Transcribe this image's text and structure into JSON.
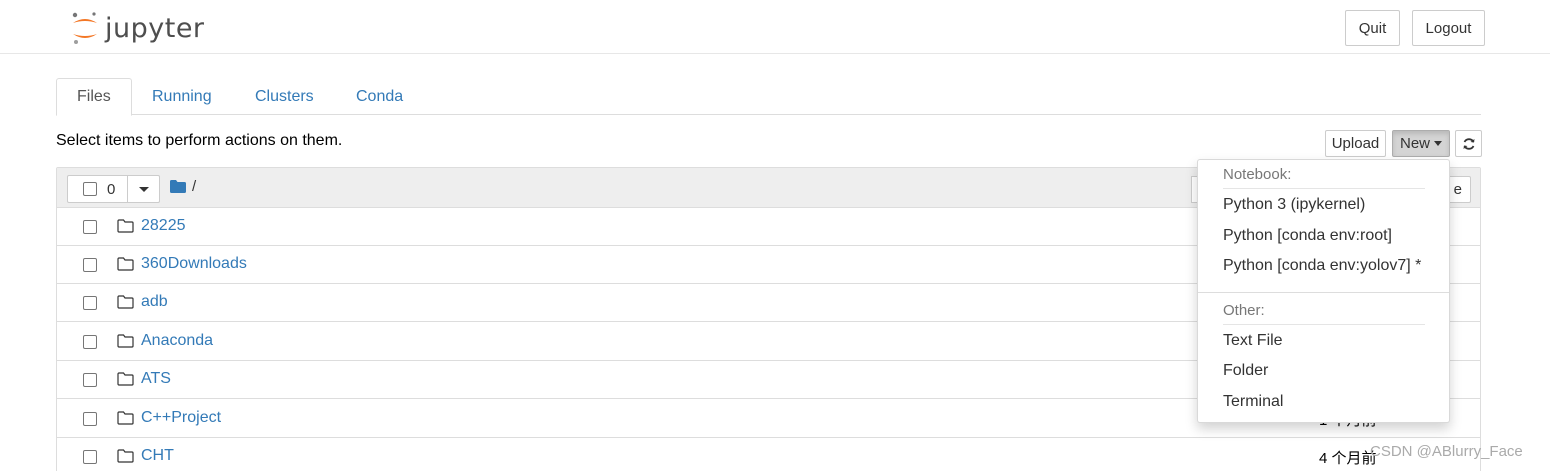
{
  "header": {
    "logo_text": "jupyter",
    "quit_label": "Quit",
    "logout_label": "Logout"
  },
  "tabs": [
    {
      "label": "Files",
      "active": true
    },
    {
      "label": "Running",
      "active": false
    },
    {
      "label": "Clusters",
      "active": false
    },
    {
      "label": "Conda",
      "active": false
    }
  ],
  "toolbar": {
    "hint": "Select items to perform actions on them.",
    "upload_label": "Upload",
    "new_label": "New",
    "refresh_icon": "refresh-icon"
  },
  "list_header": {
    "selected_count": "0",
    "breadcrumb_root": "/",
    "name_button_partial": "e"
  },
  "files": [
    {
      "name": "28225",
      "type": "folder",
      "modified": ""
    },
    {
      "name": "360Downloads",
      "type": "folder",
      "modified": ""
    },
    {
      "name": "adb",
      "type": "folder",
      "modified": ""
    },
    {
      "name": "Anaconda",
      "type": "folder",
      "modified": ""
    },
    {
      "name": "ATS",
      "type": "folder",
      "modified": ""
    },
    {
      "name": "C++Project",
      "type": "folder",
      "modified": "1 个月前"
    },
    {
      "name": "CHT",
      "type": "folder",
      "modified": "4 个月前"
    }
  ],
  "new_menu": {
    "notebook_header": "Notebook:",
    "notebook_items": [
      "Python 3 (ipykernel)",
      "Python [conda env:root]",
      "Python [conda env:yolov7] *"
    ],
    "other_header": "Other:",
    "other_items": [
      "Text File",
      "Folder",
      "Terminal"
    ]
  },
  "watermark": "CSDN @ABlurry_Face",
  "colors": {
    "link": "#337ab7",
    "logo_orange": "#f37726",
    "header_gray": "#eeeeee"
  }
}
